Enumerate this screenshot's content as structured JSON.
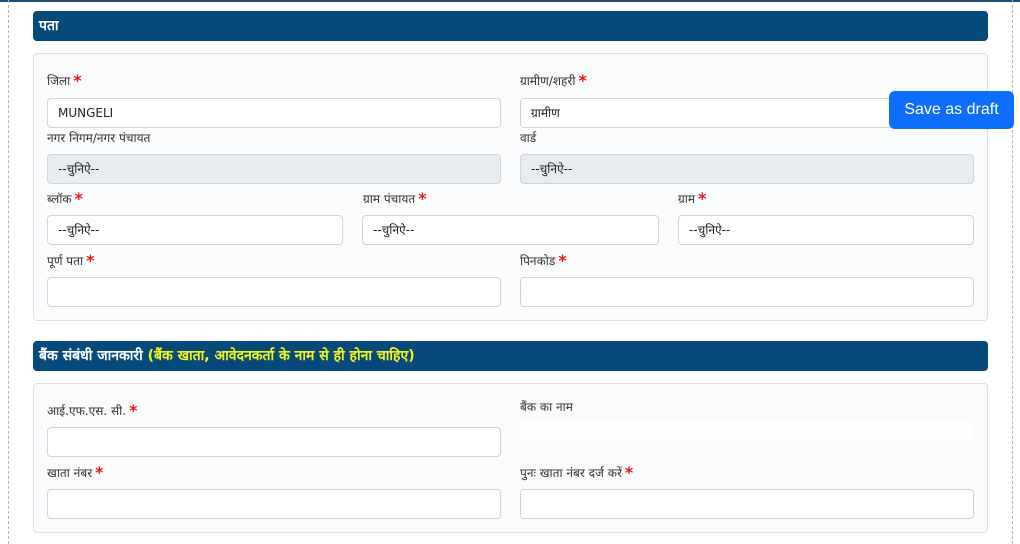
{
  "address_section": {
    "title": "पता",
    "fields": {
      "district": {
        "label": "जिला",
        "required": "*",
        "value": "MUNGELI"
      },
      "rural_urban": {
        "label": "ग्रामीण/शहरी",
        "required": "*",
        "value": "ग्रामीण"
      },
      "municipality": {
        "label": "नगर निगम/नगर पंचायत",
        "value": "--चुनिऐ--"
      },
      "ward": {
        "label": "वार्ड",
        "value": "--चुनिऐ--"
      },
      "block": {
        "label": "ब्लॉक",
        "required": "*",
        "value": "--चुनिऐ--"
      },
      "gram_panchayat": {
        "label": "ग्राम पंचायत",
        "required": "*",
        "value": "--चुनिऐ--"
      },
      "village": {
        "label": "ग्राम",
        "required": "*",
        "value": "--चुनिऐ--"
      },
      "full_address": {
        "label": "पूर्ण पता",
        "required": "*",
        "value": ""
      },
      "pincode": {
        "label": "पिनकोड",
        "required": "*",
        "value": ""
      }
    }
  },
  "bank_section": {
    "title": "बैंक संबंधी जानकारी",
    "title_highlight": "(बैंक खाता, आवेदनकर्ता के नाम से ही होना चाहिए)",
    "fields": {
      "ifsc": {
        "label": "आई.एफ.एस. सी.",
        "required": "*",
        "value": ""
      },
      "bank_name": {
        "label": "बैंक का नाम",
        "value": ""
      },
      "account_number": {
        "label": "खाता नंबर",
        "required": "*",
        "value": ""
      },
      "confirm_account_number": {
        "label": "पुनः खाता नंबर दर्ज करें",
        "required": "*",
        "value": ""
      }
    }
  },
  "actions": {
    "save_draft_label": "Save as draft"
  },
  "colors": {
    "header_bg": "#054a7a",
    "highlight": "#f5f51b",
    "primary": "#0d6efd",
    "required": "#e31b1b"
  }
}
